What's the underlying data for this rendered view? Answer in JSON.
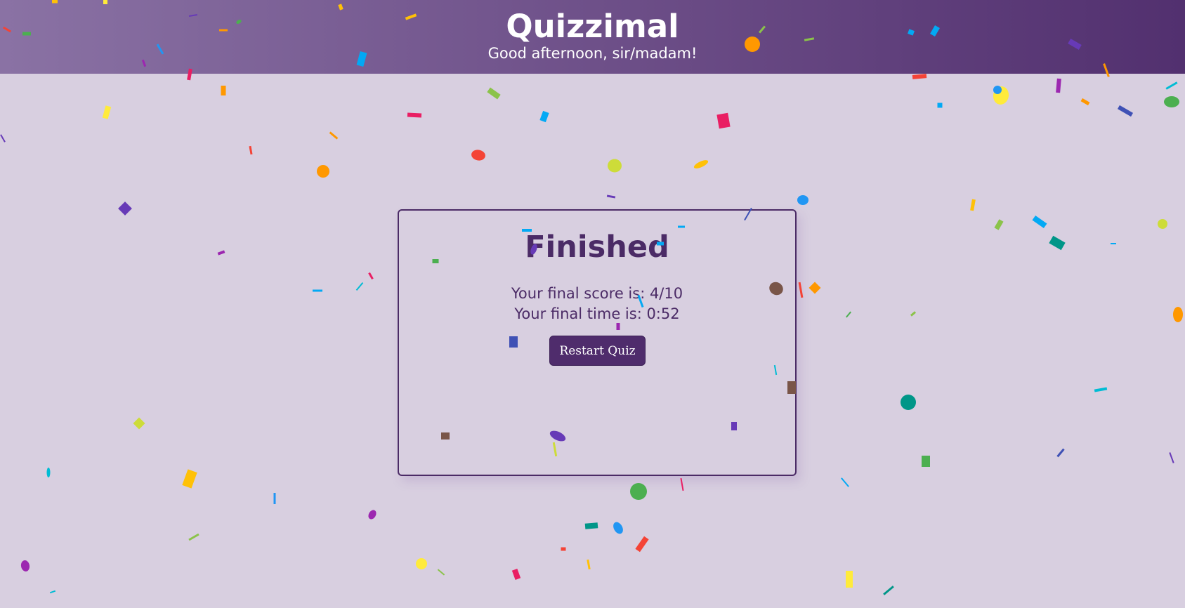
{
  "header": {
    "title": "Quizzimal",
    "greeting": "Good afternoon, sir/madam!"
  },
  "result": {
    "heading": "Finished",
    "score_text": "Your final score is: 4/10",
    "time_text": "Your final time is: 0:52",
    "restart_label": "Restart Quiz"
  },
  "theme": {
    "accent": "#4f2c6c",
    "background": "#d8cfe0",
    "header_gradient_start": "#8a72a4",
    "header_gradient_end": "#52306f"
  },
  "confetti_colors": [
    "#f44336",
    "#e91e63",
    "#9c27b0",
    "#673ab7",
    "#3f51b5",
    "#2196f3",
    "#03a9f4",
    "#00bcd4",
    "#009688",
    "#4caf50",
    "#8bc34a",
    "#cddc39",
    "#ffeb3b",
    "#ffc107",
    "#ff9800",
    "#795548"
  ]
}
